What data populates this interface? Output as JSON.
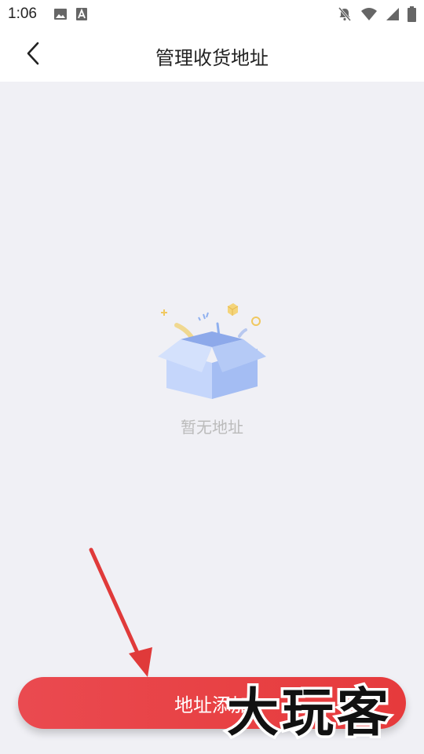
{
  "status_bar": {
    "time": "1:06"
  },
  "header": {
    "title": "管理收货地址"
  },
  "empty_state": {
    "message": "暂无地址"
  },
  "footer": {
    "add_button_label": "地址添加"
  },
  "watermark": {
    "text": "大玩客"
  },
  "colors": {
    "accent": "#e84245",
    "background": "#f0f0f5",
    "annotation_arrow": "#e03a3a"
  }
}
